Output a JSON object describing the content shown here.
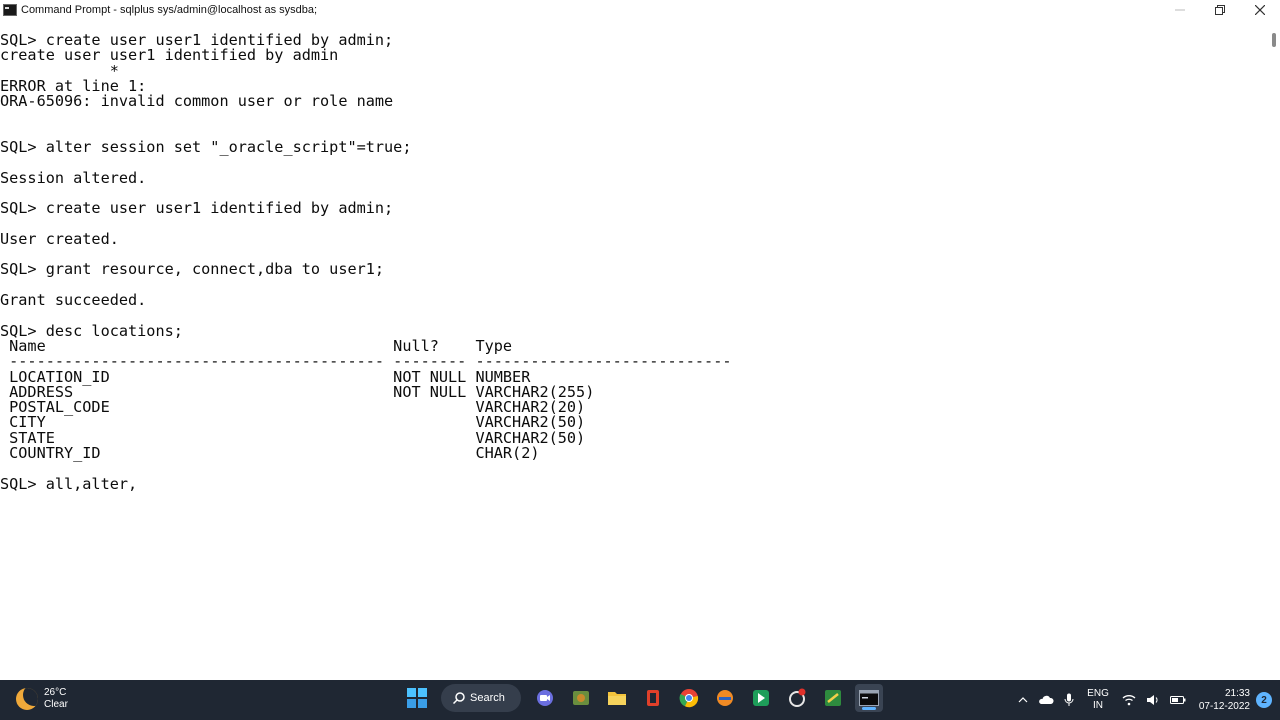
{
  "window": {
    "title": "Command Prompt - sqlplus  sys/admin@localhost as sysdba;",
    "controls": {
      "minimize": "—",
      "restore": "❐",
      "close": "✕"
    }
  },
  "console": {
    "lines": [
      "SQL> create user user1 identified by admin;",
      "create user user1 identified by admin",
      "            *",
      "ERROR at line 1:",
      "ORA-65096: invalid common user or role name",
      "",
      "",
      "SQL> alter session set \"_oracle_script\"=true;",
      "",
      "Session altered.",
      "",
      "SQL> create user user1 identified by admin;",
      "",
      "User created.",
      "",
      "SQL> grant resource, connect,dba to user1;",
      "",
      "Grant succeeded.",
      "",
      "SQL> desc locations;",
      " Name                                      Null?    Type",
      " ----------------------------------------- -------- ----------------------------",
      " LOCATION_ID                               NOT NULL NUMBER",
      " ADDRESS                                   NOT NULL VARCHAR2(255)",
      " POSTAL_CODE                                        VARCHAR2(20)",
      " CITY                                               VARCHAR2(50)",
      " STATE                                              VARCHAR2(50)",
      " COUNTRY_ID                                         CHAR(2)",
      "",
      "SQL> all,alter,"
    ]
  },
  "taskbar": {
    "weather": {
      "temp": "26°C",
      "condition": "Clear"
    },
    "search_label": "Search",
    "language": {
      "line1": "ENG",
      "line2": "IN"
    },
    "clock": {
      "time": "21:33",
      "date": "07-12-2022"
    },
    "notification_count": "2",
    "apps": [
      "start-icon",
      "search",
      "meet-icon",
      "app-icon",
      "file-explorer-icon",
      "office-icon",
      "chrome-icon",
      "app-icon",
      "app-icon",
      "app-icon",
      "app-icon",
      "terminal-icon"
    ]
  }
}
